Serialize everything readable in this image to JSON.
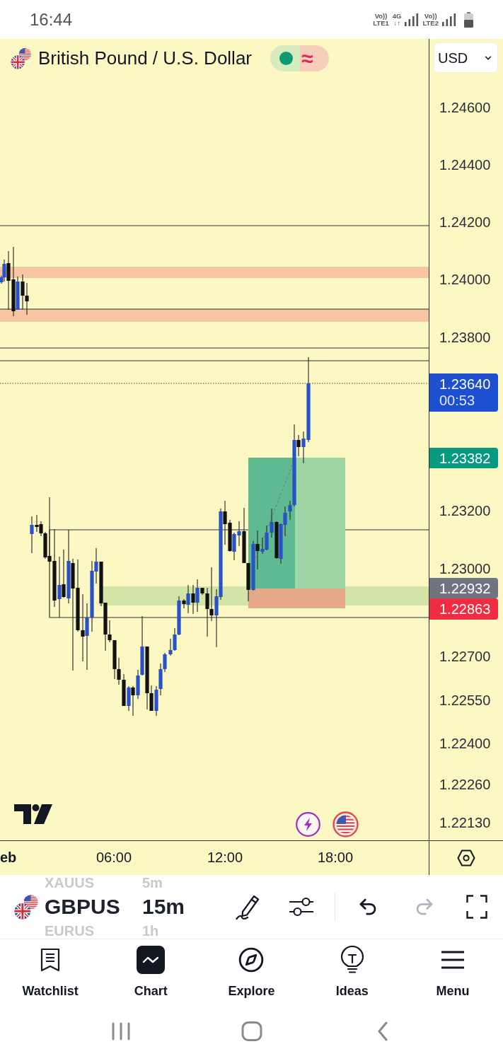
{
  "status_bar": {
    "time": "16:44",
    "network": [
      {
        "top": "Vo))",
        "bottom": "LTE1"
      },
      {
        "top": "4G",
        "bottom": "↓↑"
      },
      {
        "top": "Vo))",
        "bottom": "LTE2"
      }
    ]
  },
  "header": {
    "title": "British Pound / U.S. Dollar",
    "market_open": true,
    "delay_symbol": "≈",
    "currency": "USD"
  },
  "price_axis": {
    "ticks": [
      "1.24600",
      "1.24400",
      "1.24200",
      "1.24000",
      "1.23800",
      "1.23200",
      "1.23000",
      "1.22700",
      "1.22550",
      "1.22400",
      "1.22260",
      "1.22130"
    ],
    "price_labels": [
      {
        "price": "1.23640",
        "countdown": "00:53",
        "color": "#1d4fd0"
      },
      {
        "price": "1.23382",
        "color": "#089981"
      },
      {
        "price": "1.22932",
        "color": "#717480"
      },
      {
        "price": "1.22863",
        "color": "#f02c40"
      }
    ]
  },
  "time_axis": {
    "labels": [
      {
        "text": "eb",
        "bold": true
      },
      {
        "text": "06:00",
        "bold": false
      },
      {
        "text": "12:00",
        "bold": false
      },
      {
        "text": "18:00",
        "bold": false
      }
    ]
  },
  "symbol_picker": [
    {
      "symbol": "XAUUS",
      "interval": "5m",
      "selected": false
    },
    {
      "symbol": "GBPUS",
      "interval": "15m",
      "selected": true
    },
    {
      "symbol": "EURUS",
      "interval": "1h",
      "selected": false
    }
  ],
  "toolbar": [
    {
      "kind": "draw",
      "disabled": false
    },
    {
      "kind": "indicators",
      "disabled": false
    },
    {
      "kind": "undo",
      "disabled": false
    },
    {
      "kind": "redo",
      "disabled": true
    },
    {
      "kind": "fullscreen",
      "disabled": false
    }
  ],
  "bottom_nav": [
    {
      "kind": "watchlist",
      "label": "Watchlist",
      "selected": false
    },
    {
      "kind": "chart",
      "label": "Chart",
      "selected": true
    },
    {
      "kind": "explore",
      "label": "Explore",
      "selected": false
    },
    {
      "kind": "ideas",
      "label": "Ideas",
      "selected": false
    },
    {
      "kind": "menu",
      "label": "Menu",
      "selected": false
    }
  ]
}
